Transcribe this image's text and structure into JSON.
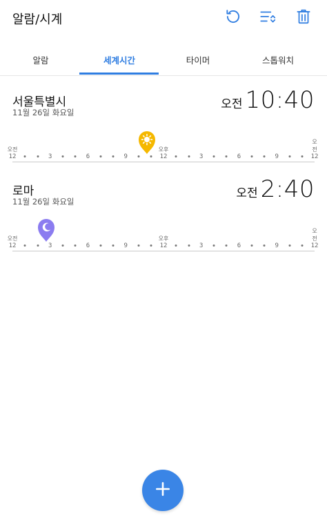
{
  "app": {
    "title": "알람/시계"
  },
  "toolbar": {
    "icons": [
      "refresh-icon",
      "sort-icon",
      "trash-icon"
    ],
    "accent": "#2f7de1"
  },
  "tabs": [
    {
      "label": "알람",
      "active": false
    },
    {
      "label": "세계시간",
      "active": true
    },
    {
      "label": "타이머",
      "active": false
    },
    {
      "label": "스톱워치",
      "active": false
    }
  ],
  "cities": [
    {
      "name": "서울특별시",
      "date": "11월 26일 화요일",
      "ampm": "오전",
      "time": "10:40",
      "marker": {
        "icon": "sun-icon",
        "color": "#f5b800",
        "hour": 10.7
      }
    },
    {
      "name": "로마",
      "date": "11월 26일 화요일",
      "ampm": "오전",
      "time": "2:40",
      "marker": {
        "icon": "moon-icon",
        "color": "#8b7cf0",
        "hour": 2.7
      }
    }
  ],
  "timeline": {
    "labels": [
      "12",
      "3",
      "6",
      "9",
      "12",
      "3",
      "6",
      "9",
      "12"
    ],
    "periods": [
      {
        "label": "오전",
        "at": 0
      },
      {
        "label": "오후",
        "at": 12
      },
      {
        "label": "오전",
        "at": 24
      }
    ]
  },
  "fab": {
    "icon": "plus-icon"
  }
}
